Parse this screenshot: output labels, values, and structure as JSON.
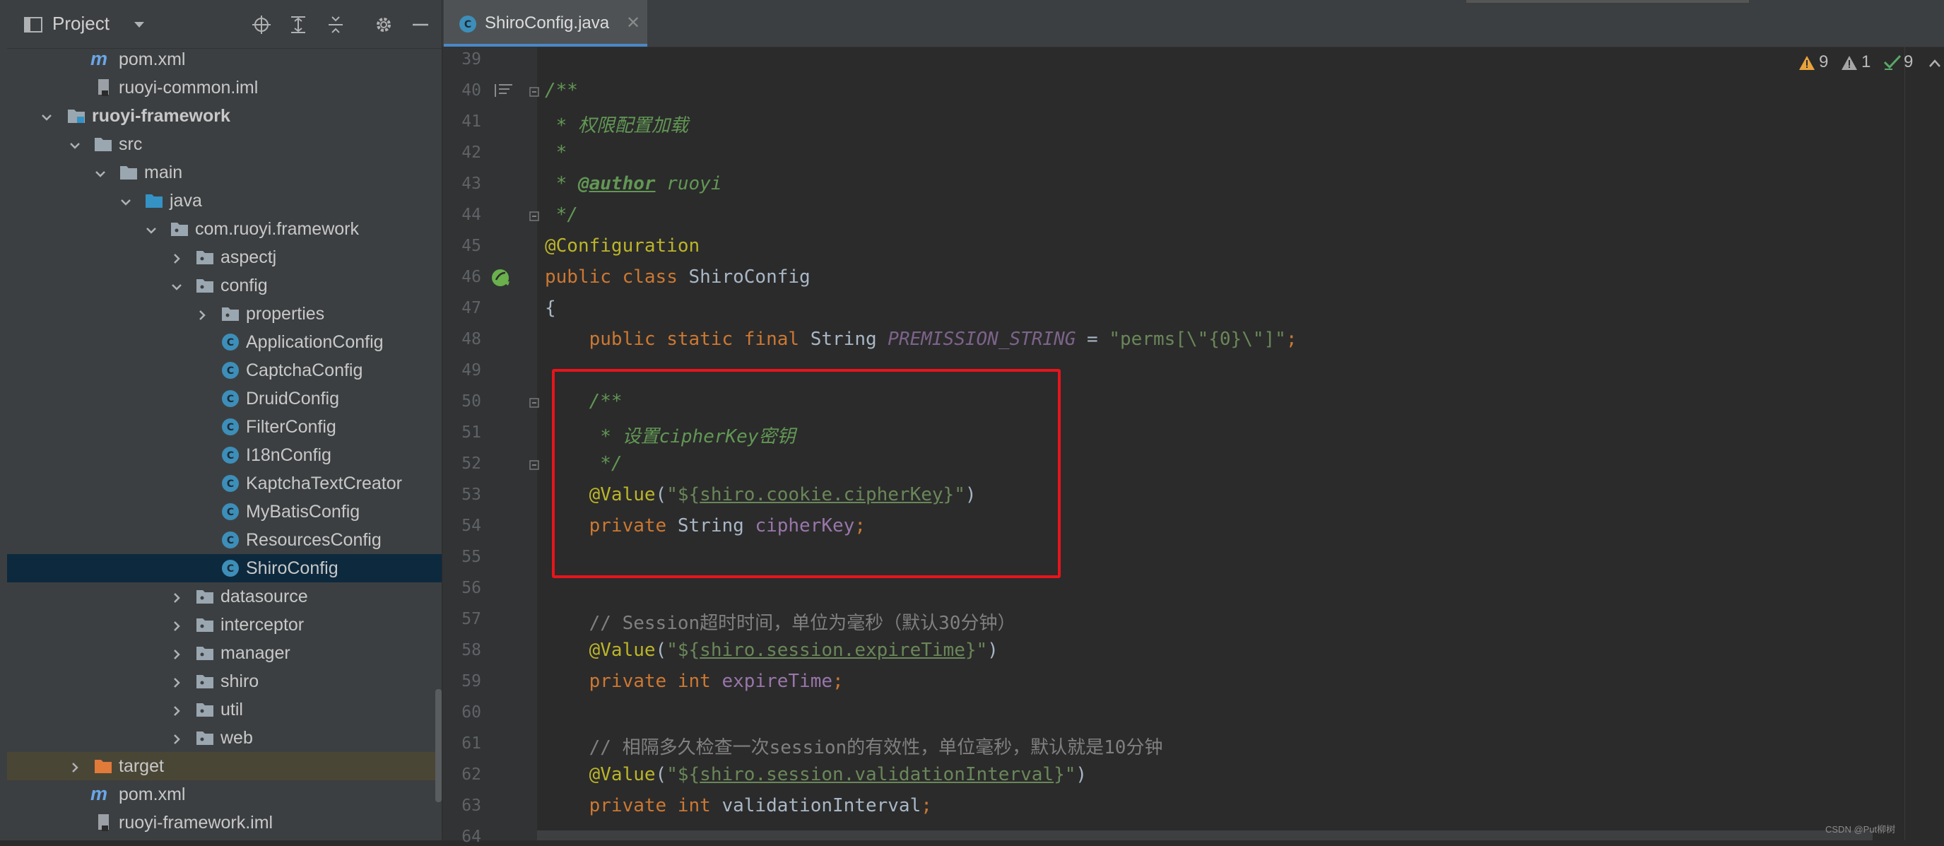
{
  "project_panel": {
    "title": "Project",
    "tree": [
      {
        "label": "pom.xml",
        "icon": "maven-icon"
      },
      {
        "label": "ruoyi-common.iml",
        "icon": "iml-file-icon"
      },
      {
        "label": "ruoyi-framework",
        "icon": "module-folder-icon"
      },
      {
        "label": "src",
        "icon": "folder-icon"
      },
      {
        "label": "main",
        "icon": "folder-icon"
      },
      {
        "label": "java",
        "icon": "source-folder-icon"
      },
      {
        "label": "com.ruoyi.framework",
        "icon": "package-icon"
      },
      {
        "label": "aspectj",
        "icon": "package-icon"
      },
      {
        "label": "config",
        "icon": "package-icon"
      },
      {
        "label": "properties",
        "icon": "package-icon"
      },
      {
        "label": "ApplicationConfig",
        "icon": "class-icon"
      },
      {
        "label": "CaptchaConfig",
        "icon": "class-icon"
      },
      {
        "label": "DruidConfig",
        "icon": "class-icon"
      },
      {
        "label": "FilterConfig",
        "icon": "class-icon"
      },
      {
        "label": "I18nConfig",
        "icon": "class-icon"
      },
      {
        "label": "KaptchaTextCreator",
        "icon": "class-icon"
      },
      {
        "label": "MyBatisConfig",
        "icon": "class-icon"
      },
      {
        "label": "ResourcesConfig",
        "icon": "class-icon"
      },
      {
        "label": "ShiroConfig",
        "icon": "class-icon"
      },
      {
        "label": "datasource",
        "icon": "package-icon"
      },
      {
        "label": "interceptor",
        "icon": "package-icon"
      },
      {
        "label": "manager",
        "icon": "package-icon"
      },
      {
        "label": "shiro",
        "icon": "package-icon"
      },
      {
        "label": "util",
        "icon": "package-icon"
      },
      {
        "label": "web",
        "icon": "package-icon"
      },
      {
        "label": "target",
        "icon": "excluded-folder-icon"
      },
      {
        "label": "pom.xml",
        "icon": "maven-icon"
      },
      {
        "label": "ruoyi-framework.iml",
        "icon": "iml-file-icon"
      }
    ]
  },
  "editor": {
    "tab_label": "ShiroConfig.java",
    "tab_close": "✕",
    "inspections": {
      "warnings": "9",
      "weak_warnings": "1",
      "ok": "9"
    },
    "line_numbers": [
      "39",
      "40",
      "41",
      "42",
      "43",
      "44",
      "45",
      "46",
      "47",
      "48",
      "49",
      "50",
      "51",
      "52",
      "53",
      "54",
      "55",
      "56",
      "57",
      "58",
      "59",
      "60",
      "61",
      "62",
      "63",
      "64"
    ],
    "code": {
      "l40": "/**",
      "l41_prefix": " * ",
      "l41_text": "权限配置加载",
      "l42": " *",
      "l43_prefix": " * ",
      "l43_tag": "@author",
      "l43_text": " ruoyi",
      "l44": " */",
      "l45": "@Configuration",
      "l46_public": "public",
      "l46_class": "class",
      "l46_name": "ShiroConfig",
      "l47": "{",
      "l48_kw": "public static final",
      "l48_type": "String",
      "l48_const": "PREMISSION_STRING",
      "l48_eq": " = ",
      "l48_str": "\"perms[\\\"{0}\\\"]\"",
      "l48_semi": ";",
      "l50": "/**",
      "l51_prefix": " * ",
      "l51_text": "设置cipherKey密钥",
      "l52": " */",
      "l53_ann": "@Value",
      "l53_open": "(",
      "l53_str_a": "\"${",
      "l53_key": "shiro.cookie.cipherKey",
      "l53_str_b": "}\"",
      "l53_close": ")",
      "l54_kw": "private",
      "l54_type": "String",
      "l54_field": "cipherKey",
      "l54_semi": ";",
      "l57": "// Session超时时间，单位为毫秒（默认30分钟）",
      "l58_ann": "@Value",
      "l58_open": "(",
      "l58_str_a": "\"${",
      "l58_key": "shiro.session.expireTime",
      "l58_str_b": "}\"",
      "l58_close": ")",
      "l59_kw": "private int",
      "l59_field": "expireTime",
      "l59_semi": ";",
      "l61": "// 相隔多久检查一次session的有效性，单位毫秒，默认就是10分钟",
      "l62_ann": "@Value",
      "l62_open": "(",
      "l62_str_a": "\"${",
      "l62_key": "shiro.session.validationInterval",
      "l62_str_b": "}\"",
      "l62_close": ")",
      "l63_kw": "private int",
      "l63_field": "validationInterval",
      "l63_semi": ";"
    }
  },
  "watermark": "CSDN @Put柳树",
  "colors": {
    "keyword": "#cc7832",
    "annotation": "#bbb529",
    "string": "#6a8759",
    "doc": "#629755",
    "field": "#9876aa",
    "highlight": "#e8141b",
    "selection": "#0d293e"
  }
}
